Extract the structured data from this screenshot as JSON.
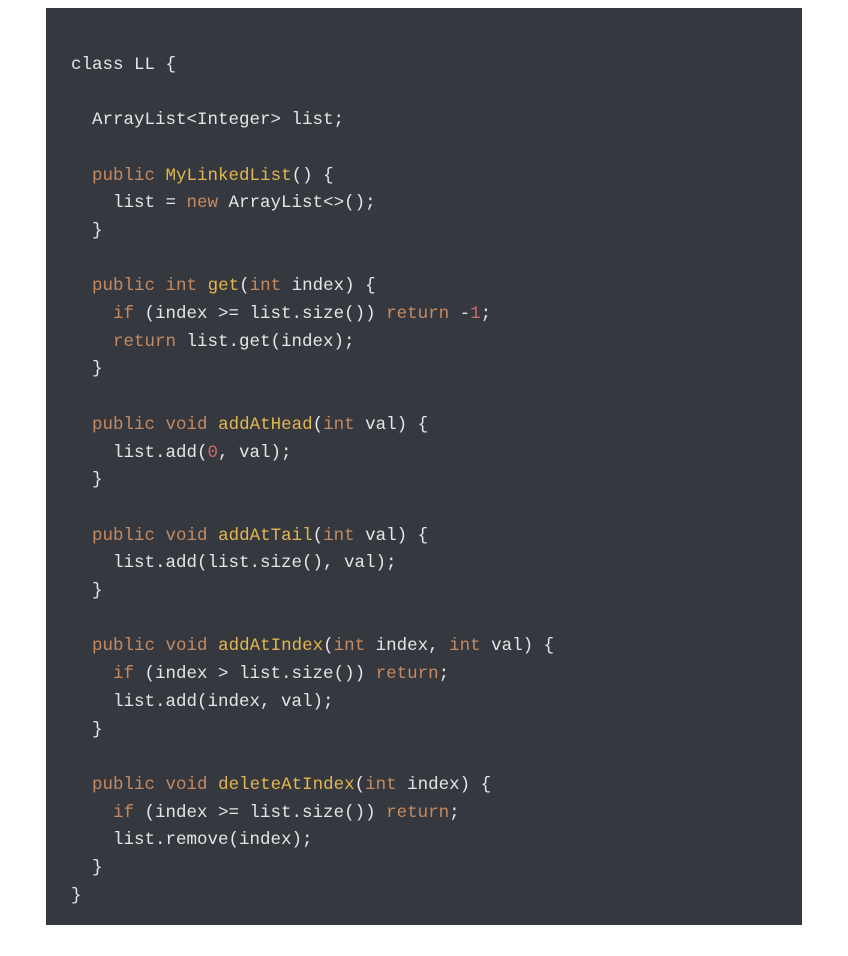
{
  "colors": {
    "background": "#35383e",
    "default": "#e5e5e5",
    "keyword": "#c48a61",
    "function": "#e2b650",
    "number": "#d16969"
  },
  "code": {
    "tokens": [
      [
        {
          "t": "class LL {",
          "c": "default"
        }
      ],
      [],
      [
        {
          "t": "    ArrayList<Integer> list;",
          "c": "default"
        }
      ],
      [],
      [
        {
          "t": "    ",
          "c": "default"
        },
        {
          "t": "public",
          "c": "keyword"
        },
        {
          "t": " ",
          "c": "default"
        },
        {
          "t": "MyLinkedList",
          "c": "func"
        },
        {
          "t": "() {",
          "c": "default"
        }
      ],
      [
        {
          "t": "      list = ",
          "c": "default"
        },
        {
          "t": "new",
          "c": "keyword"
        },
        {
          "t": " ArrayList<>();",
          "c": "default"
        }
      ],
      [
        {
          "t": "    }",
          "c": "default"
        }
      ],
      [],
      [
        {
          "t": "    ",
          "c": "default"
        },
        {
          "t": "public",
          "c": "keyword"
        },
        {
          "t": " ",
          "c": "default"
        },
        {
          "t": "int",
          "c": "keyword"
        },
        {
          "t": " ",
          "c": "default"
        },
        {
          "t": "get",
          "c": "func"
        },
        {
          "t": "(",
          "c": "default"
        },
        {
          "t": "int",
          "c": "keyword"
        },
        {
          "t": " index) {",
          "c": "default"
        }
      ],
      [
        {
          "t": "      ",
          "c": "default"
        },
        {
          "t": "if",
          "c": "keyword"
        },
        {
          "t": " (index >= list.size()) ",
          "c": "default"
        },
        {
          "t": "return",
          "c": "keyword"
        },
        {
          "t": " -",
          "c": "default"
        },
        {
          "t": "1",
          "c": "num"
        },
        {
          "t": ";",
          "c": "default"
        }
      ],
      [
        {
          "t": "      ",
          "c": "default"
        },
        {
          "t": "return",
          "c": "keyword"
        },
        {
          "t": " list.get(index);",
          "c": "default"
        }
      ],
      [
        {
          "t": "    }",
          "c": "default"
        }
      ],
      [],
      [
        {
          "t": "    ",
          "c": "default"
        },
        {
          "t": "public",
          "c": "keyword"
        },
        {
          "t": " ",
          "c": "default"
        },
        {
          "t": "void",
          "c": "keyword"
        },
        {
          "t": " ",
          "c": "default"
        },
        {
          "t": "addAtHead",
          "c": "func"
        },
        {
          "t": "(",
          "c": "default"
        },
        {
          "t": "int",
          "c": "keyword"
        },
        {
          "t": " val) {",
          "c": "default"
        }
      ],
      [
        {
          "t": "      list.add(",
          "c": "default"
        },
        {
          "t": "0",
          "c": "num"
        },
        {
          "t": ", val);",
          "c": "default"
        }
      ],
      [
        {
          "t": "    }",
          "c": "default"
        }
      ],
      [],
      [
        {
          "t": "    ",
          "c": "default"
        },
        {
          "t": "public",
          "c": "keyword"
        },
        {
          "t": " ",
          "c": "default"
        },
        {
          "t": "void",
          "c": "keyword"
        },
        {
          "t": " ",
          "c": "default"
        },
        {
          "t": "addAtTail",
          "c": "func"
        },
        {
          "t": "(",
          "c": "default"
        },
        {
          "t": "int",
          "c": "keyword"
        },
        {
          "t": " val) {",
          "c": "default"
        }
      ],
      [
        {
          "t": "      list.add(list.size(), val);",
          "c": "default"
        }
      ],
      [
        {
          "t": "    }",
          "c": "default"
        }
      ],
      [],
      [
        {
          "t": "    ",
          "c": "default"
        },
        {
          "t": "public",
          "c": "keyword"
        },
        {
          "t": " ",
          "c": "default"
        },
        {
          "t": "void",
          "c": "keyword"
        },
        {
          "t": " ",
          "c": "default"
        },
        {
          "t": "addAtIndex",
          "c": "func"
        },
        {
          "t": "(",
          "c": "default"
        },
        {
          "t": "int",
          "c": "keyword"
        },
        {
          "t": " index, ",
          "c": "default"
        },
        {
          "t": "int",
          "c": "keyword"
        },
        {
          "t": " val) {",
          "c": "default"
        }
      ],
      [
        {
          "t": "      ",
          "c": "default"
        },
        {
          "t": "if",
          "c": "keyword"
        },
        {
          "t": " (index > list.size()) ",
          "c": "default"
        },
        {
          "t": "return",
          "c": "keyword"
        },
        {
          "t": ";",
          "c": "default"
        }
      ],
      [
        {
          "t": "      list.add(index, val);",
          "c": "default"
        }
      ],
      [
        {
          "t": "    }",
          "c": "default"
        }
      ],
      [],
      [
        {
          "t": "    ",
          "c": "default"
        },
        {
          "t": "public",
          "c": "keyword"
        },
        {
          "t": " ",
          "c": "default"
        },
        {
          "t": "void",
          "c": "keyword"
        },
        {
          "t": " ",
          "c": "default"
        },
        {
          "t": "deleteAtIndex",
          "c": "func"
        },
        {
          "t": "(",
          "c": "default"
        },
        {
          "t": "int",
          "c": "keyword"
        },
        {
          "t": " index) {",
          "c": "default"
        }
      ],
      [
        {
          "t": "      ",
          "c": "default"
        },
        {
          "t": "if",
          "c": "keyword"
        },
        {
          "t": " (index >= list.size()) ",
          "c": "default"
        },
        {
          "t": "return",
          "c": "keyword"
        },
        {
          "t": ";",
          "c": "default"
        }
      ],
      [
        {
          "t": "      list.remove(index);",
          "c": "default"
        }
      ],
      [
        {
          "t": "    }",
          "c": "default"
        }
      ],
      [
        {
          "t": "  }",
          "c": "default"
        }
      ]
    ]
  }
}
